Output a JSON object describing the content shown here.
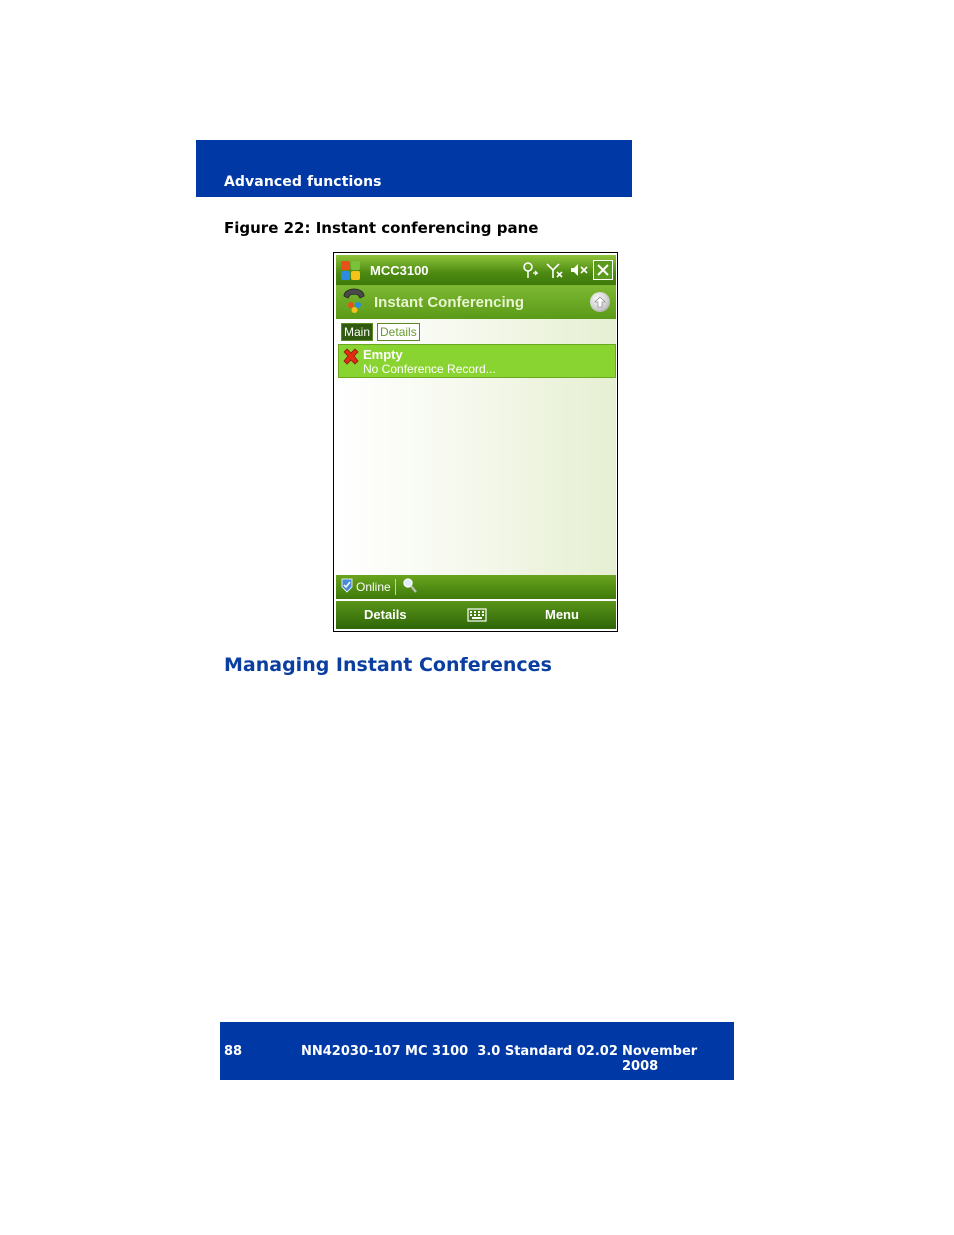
{
  "header": {
    "section": "Advanced functions"
  },
  "figure": {
    "caption": "Figure 22: Instant conferencing pane"
  },
  "device": {
    "status_title": "MCC3100",
    "status_icons": [
      "connectivity-icon",
      "signal-off-icon",
      "volume-mute-icon",
      "close-icon"
    ],
    "app_title": "Instant Conferencing",
    "tabs": [
      {
        "label": "Main",
        "active": true
      },
      {
        "label": "Details",
        "active": false
      }
    ],
    "item": {
      "title": "Empty",
      "subtitle": "No Conference Record..."
    },
    "presence": {
      "status": "Online"
    },
    "softkeys": {
      "left": "Details",
      "right": "Menu"
    },
    "colors": {
      "accent_green": "#8ad432",
      "dark_green": "#3d7a0a"
    }
  },
  "section": {
    "heading": "Managing Instant Conferences"
  },
  "footer": {
    "page": "88",
    "doc": "NN42030-107 MC 3100  3.0 Standard 02.02",
    "date": "November 2008"
  },
  "colors": {
    "brand_blue": "#0039a6",
    "heading_blue": "#0a3ea0"
  }
}
